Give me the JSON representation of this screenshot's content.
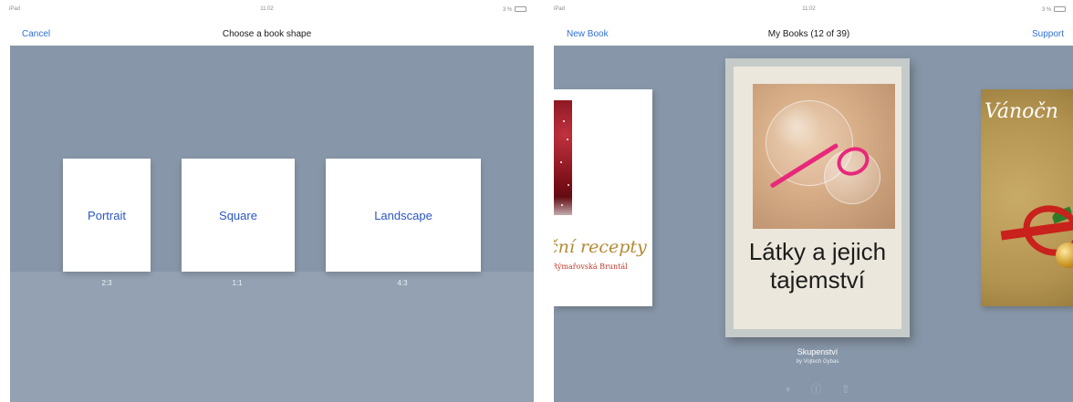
{
  "left_screen": {
    "status": {
      "carrier": "iPad",
      "time": "11:02",
      "battery": "3 %"
    },
    "nav": {
      "cancel_label": "Cancel",
      "title": "Choose a book shape"
    },
    "shapes": [
      {
        "label": "Portrait",
        "ratio": "2:3"
      },
      {
        "label": "Square",
        "ratio": "1:1"
      },
      {
        "label": "Landscape",
        "ratio": "4:3"
      }
    ],
    "colors": {
      "background": "#8796a8",
      "floor": "#93a1b2",
      "accent": "#2a55c4"
    }
  },
  "right_screen": {
    "status": {
      "carrier": "iPad",
      "time": "11:02",
      "battery": "3 %"
    },
    "nav": {
      "new_book_label": "New Book",
      "title": "My Books (12 of 39)",
      "support_label": "Support"
    },
    "books": {
      "prev": {
        "title": "ční recepty",
        "subtitle": "Rýmařovská Bruntál"
      },
      "current": {
        "cover_title": "Látky a jejich tajemství",
        "name": "Skupenství",
        "author": "by Vojtech Gybas"
      },
      "next": {
        "title": "Vánočn"
      }
    },
    "actions": [
      {
        "icon": "plus-icon",
        "glyph": "+"
      },
      {
        "icon": "info-icon",
        "glyph": "ⓘ"
      },
      {
        "icon": "share-icon",
        "glyph": "⇧"
      }
    ],
    "colors": {
      "background": "#8796a8",
      "link": "#2f6fd9"
    }
  }
}
